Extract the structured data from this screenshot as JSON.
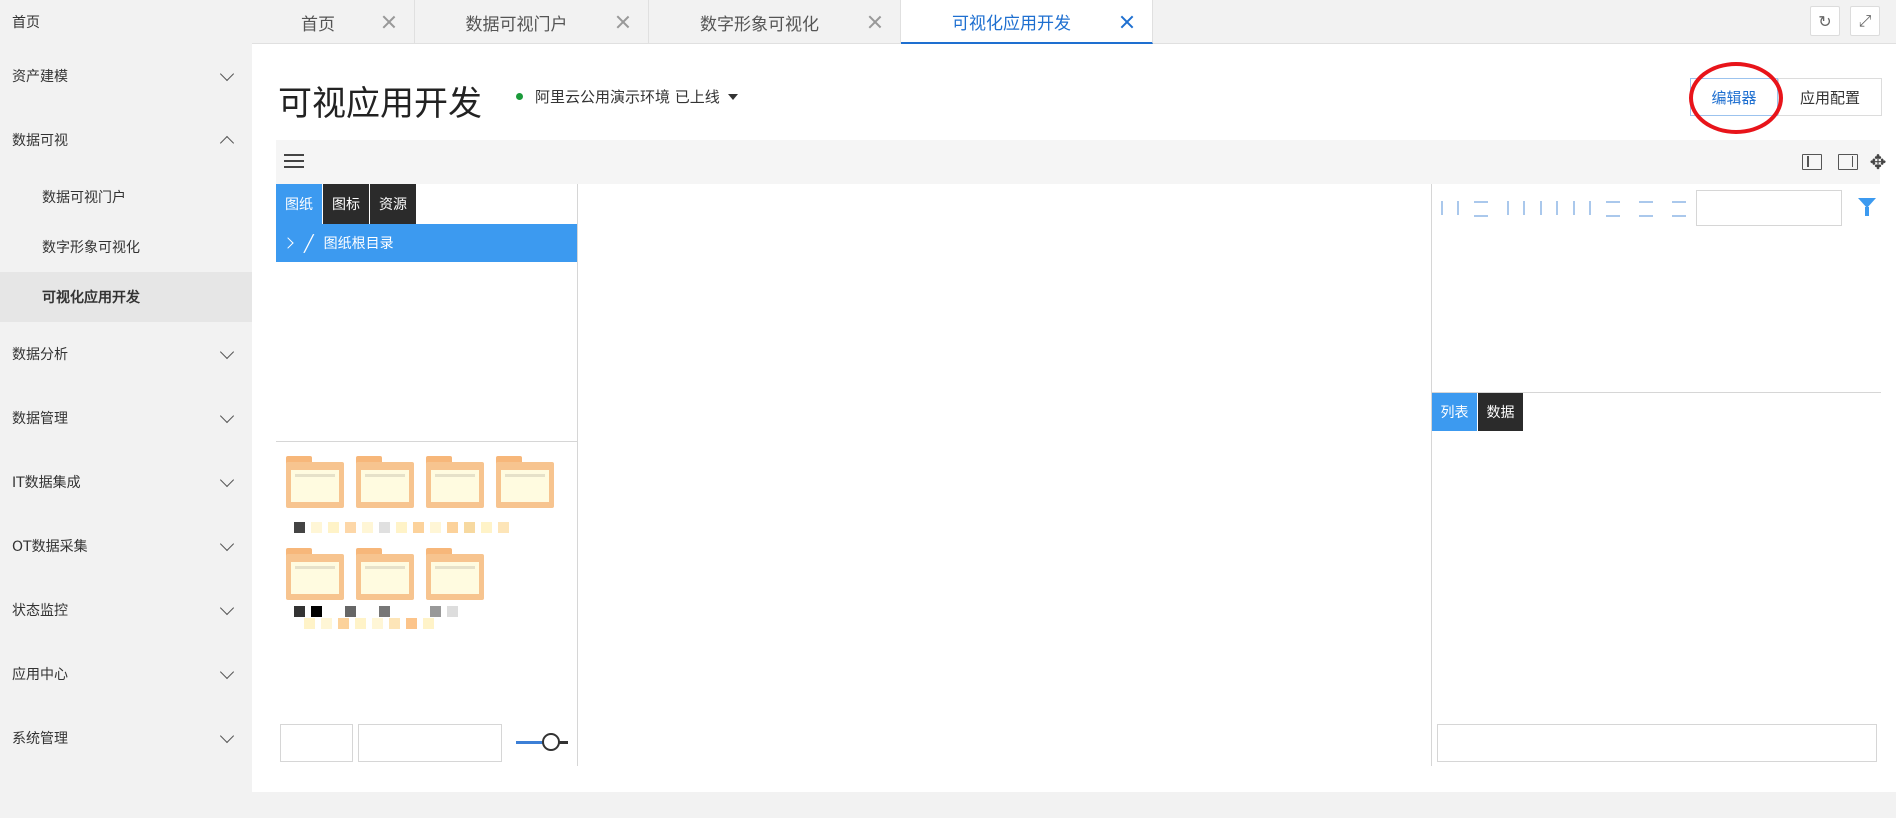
{
  "sidebar": {
    "home": "首页",
    "groups": [
      {
        "label": "资产建模",
        "expanded": false
      },
      {
        "label": "数据可视",
        "expanded": true,
        "children": [
          "数据可视门户",
          "数字形象可视化",
          "可视化应用开发"
        ],
        "active_child": "可视化应用开发"
      },
      {
        "label": "数据分析",
        "expanded": false
      },
      {
        "label": "数据管理",
        "expanded": false
      },
      {
        "label": "IT数据集成",
        "expanded": false
      },
      {
        "label": "OT数据采集",
        "expanded": false
      },
      {
        "label": "状态监控",
        "expanded": false
      },
      {
        "label": "应用中心",
        "expanded": false
      },
      {
        "label": "系统管理",
        "expanded": false
      }
    ]
  },
  "tabs": [
    {
      "label": "首页",
      "active": false
    },
    {
      "label": "数据可视门户",
      "active": false
    },
    {
      "label": "数字形象可视化",
      "active": false
    },
    {
      "label": "可视化应用开发",
      "active": true
    }
  ],
  "tab_tools": {
    "refresh": "↻",
    "fullscreen": "⤢"
  },
  "header": {
    "title": "可视应用开发",
    "environment": "阿里云公用演示环境 已上线",
    "status_color": "#1a9a3a",
    "editor_button": "编辑器",
    "config_button": "应用配置"
  },
  "left_panel": {
    "tabs": [
      "图纸",
      "图标",
      "资源"
    ],
    "active_tab": "图纸",
    "tree_root": "图纸根目录"
  },
  "right_panel": {
    "tabs": [
      "列表",
      "数据"
    ],
    "active_tab": "列表"
  },
  "colors": {
    "accent": "#3c9af0",
    "link": "#1e6fd0",
    "highlight": "#e8141a"
  }
}
